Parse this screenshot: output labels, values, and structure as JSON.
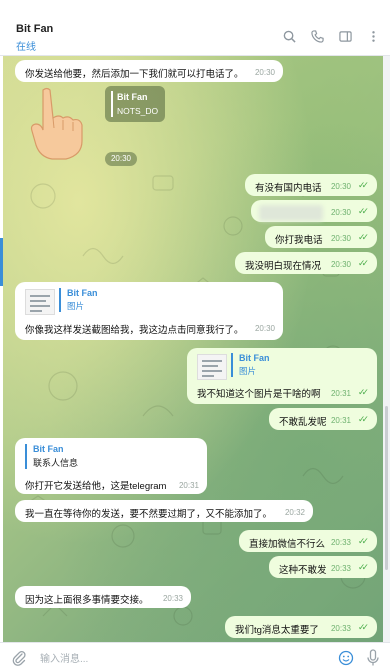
{
  "header": {
    "name": "Bit Fan",
    "status": "在线",
    "icons": [
      "search-icon",
      "phone-icon",
      "sidebar-icon",
      "more-icon"
    ]
  },
  "date_pill": "20:30",
  "messages": [
    {
      "dir": "in",
      "text": "你发送给他要，然后添加一下我们就可以打电话了。",
      "time": "20:30"
    },
    {
      "dir": "sticker_forward",
      "name": "Bit Fan",
      "sub": "NOTS_DO"
    },
    {
      "dir": "out",
      "text": "有没有国内电话",
      "time": "20:30"
    },
    {
      "dir": "out",
      "text": "",
      "time": "20:30"
    },
    {
      "dir": "out",
      "text": "你打我电话",
      "time": "20:30"
    },
    {
      "dir": "out",
      "text": "我没明白现在情况",
      "time": "20:30"
    },
    {
      "dir": "in",
      "fwd_name": "Bit Fan",
      "fwd_sub": "图片",
      "text": "你像我这样发送截图给我，我这边点击同意我行了。",
      "time": "20:30"
    },
    {
      "dir": "out",
      "fwd_name": "Bit Fan",
      "fwd_sub": "图片",
      "text": "我不知道这个图片是干啥的啊",
      "time": "20:31"
    },
    {
      "dir": "out",
      "text": "不敢乱发呢",
      "time": "20:31"
    },
    {
      "dir": "in",
      "fwd_name": "Bit Fan",
      "fwd_sub": "联系人信息",
      "text": "你打开它发送给他，这是telegram",
      "time": "20:31"
    },
    {
      "dir": "in",
      "text": "我一直在等待你的发送，要不然要过期了，又不能添加了。",
      "time": "20:32"
    },
    {
      "dir": "out",
      "text": "直接加微信不行么",
      "time": "20:33"
    },
    {
      "dir": "out",
      "text": "这种不敢发",
      "time": "20:33"
    },
    {
      "dir": "in",
      "text": "因为这上面很多事情要交接。",
      "time": "20:33"
    },
    {
      "dir": "out",
      "text": "我们tg消息太重要了",
      "time": "20:33"
    }
  ],
  "composer": {
    "placeholder": "输入消息...",
    "icons": [
      "attach-icon",
      "emoji-icon",
      "microphone-icon"
    ]
  },
  "colors": {
    "accent": "#3a8ed8",
    "outgoing_bubble": "#effdde",
    "incoming_bubble": "#ffffff",
    "read_ticks": "#4fae4e"
  }
}
